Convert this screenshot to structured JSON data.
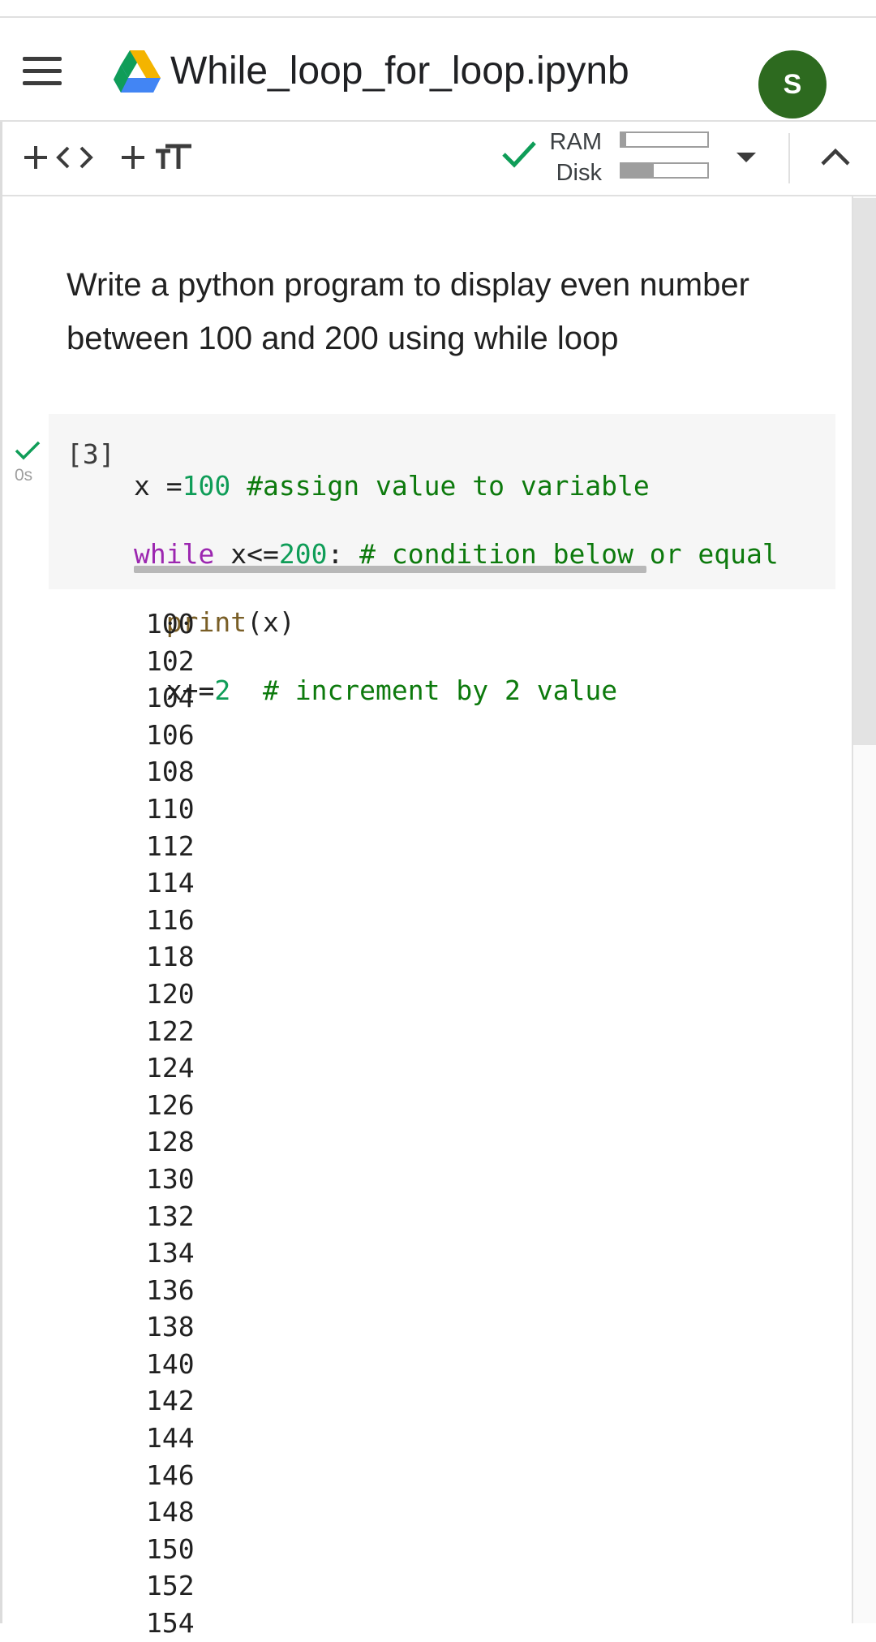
{
  "header": {
    "title": "While_loop_for_loop.ipynb",
    "avatar_letter": "S",
    "icons": {
      "menu": "hamburger-menu-icon",
      "drive": "google-drive-logo"
    }
  },
  "toolbar": {
    "add_code_icon": "plus-code-icon",
    "add_text_icon": "plus-text-icon",
    "connected_icon": "check-icon",
    "ram_label": "RAM",
    "disk_label": "Disk",
    "ram_usage": 0.06,
    "disk_usage": 0.38,
    "dropdown_icon": "caret-down-icon",
    "collapse_icon": "chevron-up-icon"
  },
  "text_cell": {
    "line1": "Write a python program to display even number",
    "line2": "between 100 and 200 using while loop"
  },
  "code_cell": {
    "execution_count": "[3]",
    "exec_time": "0s",
    "line1": {
      "var": "x =",
      "num": "100",
      "comment": " #assign value to variable"
    },
    "line2": {
      "kw": "while",
      "cond": " x<=",
      "num": "200",
      "colon": ":",
      "comment": " # condition below or equal"
    },
    "line3": {
      "indent": "  ",
      "fn": "print",
      "args": "(x)"
    },
    "line4": {
      "indent": "  ",
      "op": "x+=",
      "num": "2",
      "comment": "  # increment by 2 value"
    }
  },
  "output": [
    "100",
    "102",
    "104",
    "106",
    "108",
    "110",
    "112",
    "114",
    "116",
    "118",
    "120",
    "122",
    "124",
    "126",
    "128",
    "130",
    "132",
    "134",
    "136",
    "138",
    "140",
    "142",
    "144",
    "146",
    "148",
    "150",
    "152",
    "154"
  ],
  "colors": {
    "avatar": "#2d6a1f",
    "check": "#0f9d58",
    "keyword": "#9c27b0",
    "number": "#0f9d58",
    "comment": "#0d7a0d"
  }
}
